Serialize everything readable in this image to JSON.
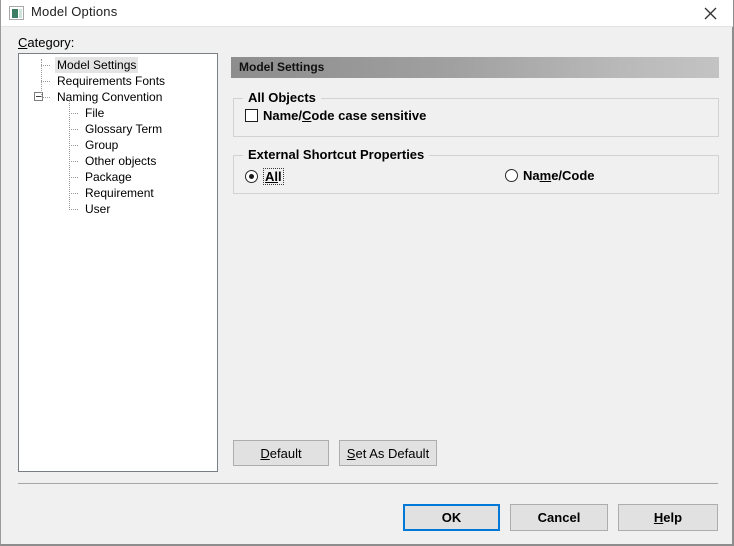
{
  "window": {
    "title": "Model Options",
    "icon": "model-options-icon",
    "close_icon": "close-icon"
  },
  "category": {
    "label_prefix": "C",
    "label_rest": "ategory:",
    "tree": [
      {
        "label": "Model Settings",
        "level": 0,
        "selected": true,
        "expander": false
      },
      {
        "label": "Requirements Fonts",
        "level": 0,
        "selected": false,
        "expander": false
      },
      {
        "label": "Naming Convention",
        "level": 0,
        "selected": false,
        "expander": true
      },
      {
        "label": "File",
        "level": 1,
        "selected": false,
        "expander": false
      },
      {
        "label": "Glossary Term",
        "level": 1,
        "selected": false,
        "expander": false
      },
      {
        "label": "Group",
        "level": 1,
        "selected": false,
        "expander": false
      },
      {
        "label": "Other objects",
        "level": 1,
        "selected": false,
        "expander": false
      },
      {
        "label": "Package",
        "level": 1,
        "selected": false,
        "expander": false
      },
      {
        "label": "Requirement",
        "level": 1,
        "selected": false,
        "expander": false
      },
      {
        "label": "User",
        "level": 1,
        "selected": false,
        "expander": false
      }
    ]
  },
  "pane": {
    "header": "Model Settings",
    "groups": [
      {
        "legend": "All Objects",
        "checkbox": {
          "label_a": "Name/",
          "label_key": "C",
          "label_b": "ode case sensitive",
          "checked": false
        }
      },
      {
        "legend": "External Shortcut Properties",
        "radios": [
          {
            "label_a": "",
            "label_key": "Al",
            "label_b": "l",
            "checked": true,
            "focused": true
          },
          {
            "label_a": "Na",
            "label_key": "m",
            "label_b": "e/Code",
            "checked": false,
            "focused": false
          }
        ]
      }
    ],
    "buttons": {
      "default": {
        "key": "D",
        "rest": "efault"
      },
      "set_as_default": {
        "key": "S",
        "rest": "et As Default"
      }
    }
  },
  "footer": {
    "ok": "OK",
    "cancel": "Cancel",
    "help": {
      "key": "H",
      "rest": "elp"
    }
  },
  "colors": {
    "dialog_bg": "#f0f0f0",
    "titlebar_bg": "#ffffff",
    "tree_bg": "#ffffff",
    "selection_bg": "#e4e4e4",
    "header_gradient_start": "#8d8d8d",
    "header_gradient_end": "#c3c3c3",
    "focus_blue": "#0078d7",
    "group_border": "#d2d2d2",
    "icon_green": "#3c7d64"
  }
}
